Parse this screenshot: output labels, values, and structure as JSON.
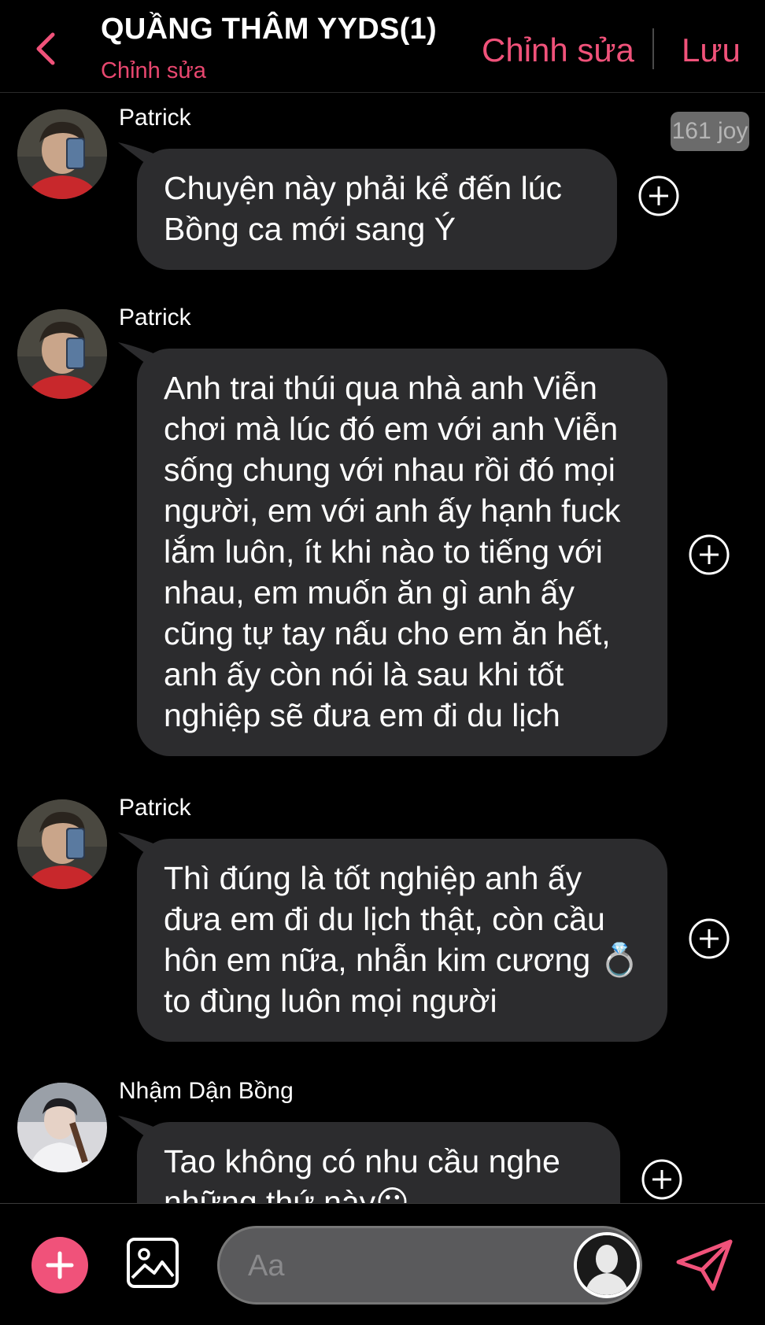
{
  "header": {
    "title": "QUẦNG THÂM YYDS(1)",
    "subtitle": "Chỉnh sửa",
    "edit_label": "Chỉnh sửa",
    "save_label": "Lưu"
  },
  "joy_badge": "161 joy",
  "messages": [
    {
      "sender": "Patrick",
      "text": "Chuyện này phải kể đến lúc Bồng ca mới sang Ý"
    },
    {
      "sender": "Patrick",
      "text": "Anh trai thúi qua nhà anh Viễn chơi mà lúc đó em với anh Viễn sống chung với nhau rồi đó mọi người, em với anh ấy hạnh fuck lắm luôn, ít khi nào to tiếng với nhau, em muốn ăn gì anh ấy cũng tự tay nấu cho em ăn hết, anh ấy còn nói là sau khi tốt nghiệp sẽ đưa em đi du lịch"
    },
    {
      "sender": "Patrick",
      "text": "Thì đúng là tốt nghiệp anh ấy đưa em đi du lịch thật, còn cầu hôn em nữa, nhẫn kim cương 💍 to đùng luôn mọi người"
    },
    {
      "sender": "Nhậm Dận Bồng",
      "text": "Tao không có nhu cầu nghe những thứ này😶"
    }
  ],
  "composer": {
    "placeholder": "Aa"
  },
  "icons": {
    "back": "chevron-left-icon",
    "add": "plus-icon",
    "image": "image-icon",
    "send": "send-icon",
    "message_action": "plus-circle-icon"
  },
  "colors": {
    "accent": "#f0527a",
    "bubble": "#2c2c2e",
    "background": "#000000"
  }
}
